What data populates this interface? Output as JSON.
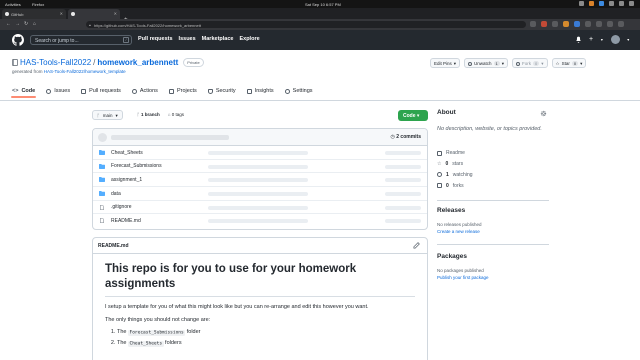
{
  "os": {
    "activities": "Activities",
    "app_name": "Firefox",
    "clock": "Sat Sep 10  6:57 PM"
  },
  "browser": {
    "tabs": [
      {
        "label": "GitHub"
      },
      {
        "label": "https://github.com/HAS-Tools-Fall2022/homework_arbennett"
      }
    ],
    "url": "https://github.com/HAS-Tools-Fall2022/homework_arbennett"
  },
  "github": {
    "search_placeholder": "Search or jump to...",
    "search_shortcut": "/",
    "nav": [
      "Pull requests",
      "Issues",
      "Marketplace",
      "Explore"
    ]
  },
  "repo": {
    "owner": "HAS-Tools-Fall2022",
    "separator": "/",
    "name": "homework_arbennett",
    "visibility": "Private",
    "generated_prefix": "generated from",
    "template": "HAS-Tools-Fall2022/homework_template",
    "actions": {
      "edit_pins": "Edit Pins",
      "unwatch": "Unwatch",
      "unwatch_count": "1",
      "fork": "Fork",
      "fork_count": "0",
      "star": "Star",
      "star_count": "0"
    },
    "tabs": [
      {
        "label": "Code",
        "selected": true
      },
      {
        "label": "Issues"
      },
      {
        "label": "Pull requests"
      },
      {
        "label": "Actions"
      },
      {
        "label": "Projects"
      },
      {
        "label": "Security"
      },
      {
        "label": "Insights"
      },
      {
        "label": "Settings"
      }
    ],
    "branch": "main",
    "branches": "1 branch",
    "tags": "0 tags",
    "code_button": "Code",
    "commits": "2 commits",
    "files": [
      {
        "name": "Cheat_Sheets",
        "type": "dir"
      },
      {
        "name": "Forecast_Submissions",
        "type": "dir"
      },
      {
        "name": "assignment_1",
        "type": "dir"
      },
      {
        "name": "data",
        "type": "dir"
      },
      {
        "name": ".gitignore",
        "type": "file"
      },
      {
        "name": "README.md",
        "type": "file"
      }
    ]
  },
  "readme": {
    "label": "README.md",
    "heading": "This repo is for you to use for your homework assignments",
    "para1": "I setup a template for you of what this might look like but you can re-arrange and edit this however you want.",
    "para2": "The only things you should not change are:",
    "items": [
      {
        "pre": "The ",
        "code": "Forecast_Submissions",
        "post": " folder"
      },
      {
        "pre": "The ",
        "code": "Cheat_Sheets",
        "post": " folders"
      }
    ]
  },
  "sidebar": {
    "about_title": "About",
    "about_desc": "No description, website, or topics provided.",
    "readme_link": "Readme",
    "stars": {
      "count": "0",
      "label": "stars"
    },
    "watching": {
      "count": "1",
      "label": "watching"
    },
    "forks": {
      "count": "0",
      "label": "forks"
    },
    "releases_title": "Releases",
    "releases_none": "No releases published",
    "create_release": "Create a new release",
    "packages_title": "Packages",
    "packages_none": "No packages published",
    "publish_package": "Publish your first package"
  },
  "colors": {
    "accent_link": "#0969da",
    "code_button": "#2da44e",
    "header_bg": "#24292f",
    "selected_tab_underline": "#fd8c73"
  }
}
